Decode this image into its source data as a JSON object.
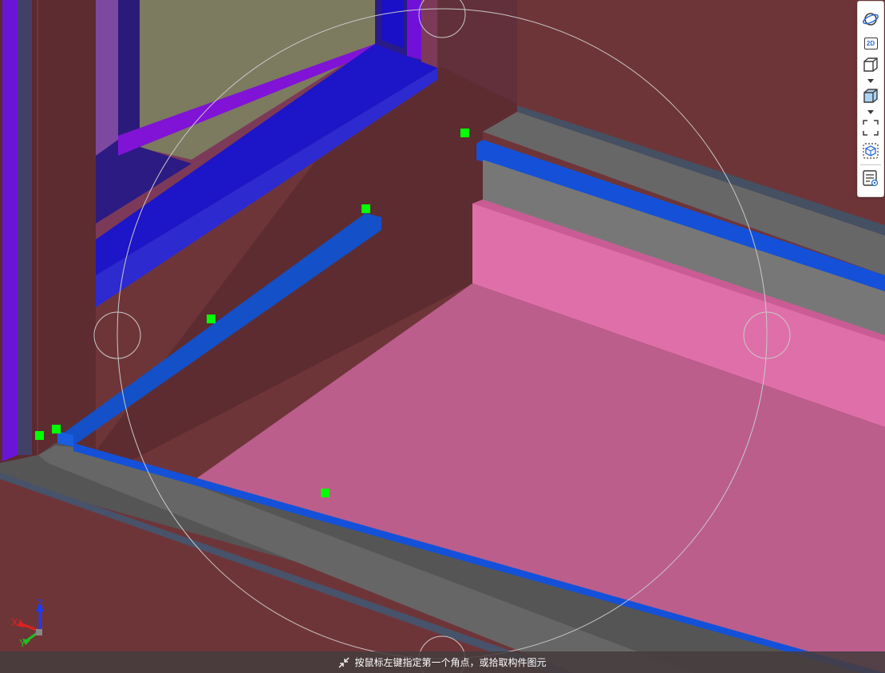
{
  "toolbar": {
    "buttons": [
      {
        "name": "orbit-button",
        "icon": "orbit-icon"
      },
      {
        "name": "view-2d-button",
        "icon": "2d-view-icon",
        "label": "2D"
      },
      {
        "name": "view-3d-wireframe-button",
        "icon": "box-outline-icon"
      },
      {
        "name": "view-3d-shaded-button",
        "icon": "box-shaded-icon"
      },
      {
        "name": "zoom-extents-button",
        "icon": "fit-frame-icon"
      },
      {
        "name": "component-view-button",
        "icon": "component-cube-icon"
      },
      {
        "name": "property-viewer-button",
        "icon": "property-list-icon"
      }
    ]
  },
  "axis": {
    "x": "X",
    "y": "Y",
    "z": "Z"
  },
  "status": {
    "prompt": "按鼠标左键指定第一个角点，或拾取构件图元",
    "icon": "collapse-arrows-icon"
  },
  "colors": {
    "wall": "#6e3538",
    "wall_dark": "#5b2c2f",
    "floor_slab": "#bb5e8c",
    "skirting": "#df6fa9",
    "ledge_top": "#777777",
    "ledge_face": "#636363",
    "edge_beam": "#1454d6",
    "window_frame": "#2218c8",
    "window_frame_inner": "#7013d6",
    "window_glass": "#7c7a5f",
    "grip_point": "#00ff00",
    "orbit_guide": "#c9c9c9",
    "accent": "#2b6dd6"
  }
}
